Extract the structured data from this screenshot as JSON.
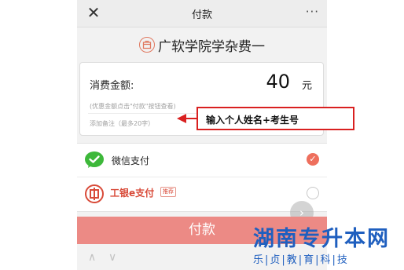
{
  "navbar": {
    "close_icon": "close-icon",
    "title": "付款",
    "more_label": "···"
  },
  "merchant": {
    "icon": "shop-icon",
    "name": "广软学院学杂费一"
  },
  "payment_form": {
    "amount_label": "消费金额:",
    "amount_value": "40",
    "currency_unit": "元",
    "discount_hint": "(优惠金额点击\"付款\"按钮查看)",
    "remark_placeholder": "添加备注（最多20字）"
  },
  "payment_methods": [
    {
      "label": "微信支付",
      "icon": "wechat-pay-icon",
      "selected": true
    },
    {
      "label": "工银e支付",
      "badge": "推荐",
      "icon": "icbc-icon",
      "selected": false
    }
  ],
  "pay_button_label": "付款",
  "annotation": {
    "text": "输入个人姓名+考生号",
    "color": "#d92020"
  },
  "watermark": {
    "title": "湖南专升本网",
    "subtitle": "乐|贞|教|育|科|技"
  },
  "colors": {
    "accent": "#ee6f5d",
    "pay_button": "#ec8a85",
    "wechat_green": "#3db83a",
    "icbc_red": "#d84a38",
    "watermark_blue": "#1f5fbf"
  }
}
